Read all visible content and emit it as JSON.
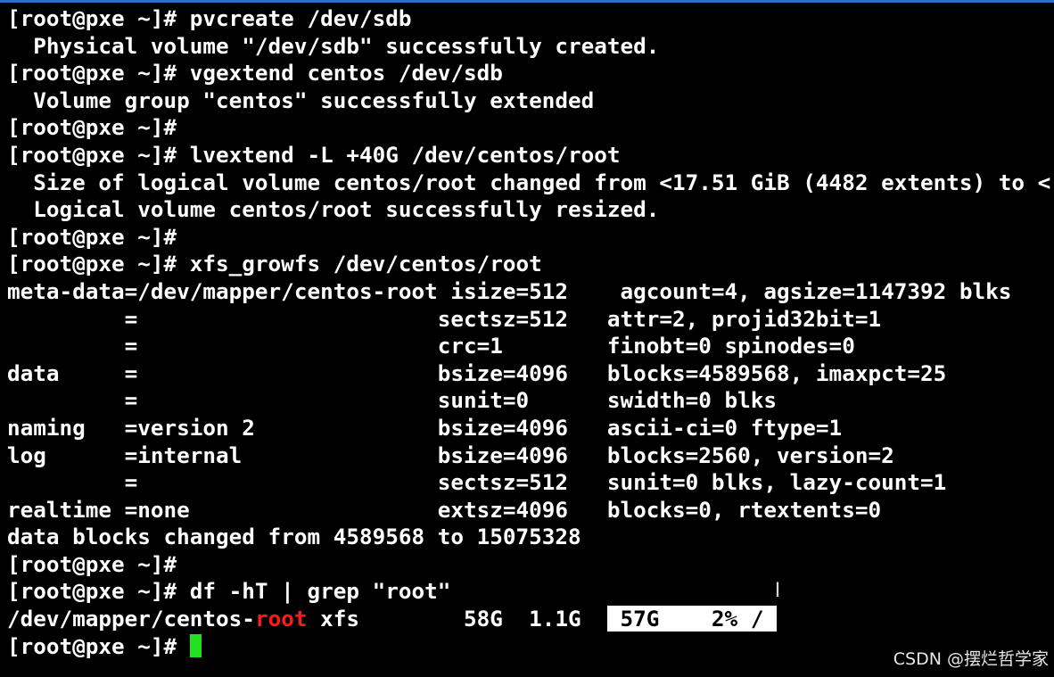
{
  "terminal": {
    "lines": [
      "[root@pxe ~]# pvcreate /dev/sdb",
      "  Physical volume \"/dev/sdb\" successfully created.",
      "[root@pxe ~]# vgextend centos /dev/sdb",
      "  Volume group \"centos\" successfully extended",
      "[root@pxe ~]#",
      "[root@pxe ~]# lvextend -L +40G /dev/centos/root",
      "  Size of logical volume centos/root changed from <17.51 GiB (4482 extents) to <",
      "  Logical volume centos/root successfully resized.",
      "[root@pxe ~]#",
      "[root@pxe ~]# xfs_growfs /dev/centos/root",
      "meta-data=/dev/mapper/centos-root isize=512    agcount=4, agsize=1147392 blks",
      "         =                       sectsz=512   attr=2, projid32bit=1",
      "         =                       crc=1        finobt=0 spinodes=0",
      "data     =                       bsize=4096   blocks=4589568, imaxpct=25",
      "         =                       sunit=0      swidth=0 blks",
      "naming   =version 2              bsize=4096   ascii-ci=0 ftype=1",
      "log      =internal               bsize=4096   blocks=2560, version=2",
      "         =                       sectsz=512   sunit=0 blks, lazy-count=1",
      "realtime =none                   extsz=4096   blocks=0, rtextents=0",
      "data blocks changed from 4589568 to 15075328",
      "[root@pxe ~]#",
      "[root@pxe ~]# df -hT | grep \"root\""
    ],
    "df_output": {
      "prefix": "/dev/mapper/centos-",
      "match": "root",
      "middle": " xfs        58G  1.1G  ",
      "selected": " 57G    2% / "
    },
    "prompt": "[root@pxe ~]# ",
    "colors": {
      "background": "#000000",
      "text": "#ffffff",
      "grep_match": "#ff1a1a",
      "cursor": "#22e022",
      "selection_bg": "#ffffff"
    }
  },
  "overlay": {
    "mouse_cursor_icon": "I",
    "watermark": "CSDN @摆烂哲学家"
  }
}
